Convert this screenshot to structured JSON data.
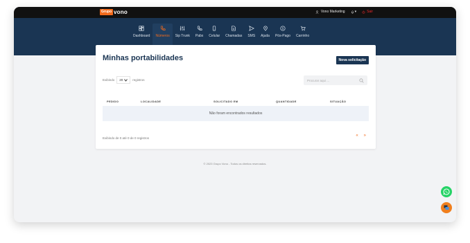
{
  "brand": {
    "badge": "Grupo",
    "name": "vono"
  },
  "topbar": {
    "user_name": "Vono Marketing",
    "bell_caret": "▾",
    "logout_label": "Sair"
  },
  "nav": {
    "items": [
      {
        "label": "Dashboard",
        "icon": "dashboard-icon",
        "active": false
      },
      {
        "label": "Números",
        "icon": "phone-number-icon",
        "active": true
      },
      {
        "label": "Sip Trunk",
        "icon": "sliders-icon",
        "active": false
      },
      {
        "label": "Pabx",
        "icon": "phone-icon",
        "active": false
      },
      {
        "label": "Celular",
        "icon": "mobile-icon",
        "active": false
      },
      {
        "label": "Chamadas",
        "icon": "file-icon",
        "active": false
      },
      {
        "label": "SMS",
        "icon": "send-icon",
        "active": false
      },
      {
        "label": "Ajuda",
        "icon": "help-icon",
        "active": false
      },
      {
        "label": "Pós-Pago",
        "icon": "dollar-icon",
        "active": false
      },
      {
        "label": "Carrinho",
        "icon": "cart-icon",
        "active": false
      }
    ]
  },
  "page": {
    "title": "Minhas portabilidades",
    "new_button": "Nova solicitação",
    "show_prefix": "Exibindo",
    "page_size": "20",
    "show_suffix": "registros",
    "search_placeholder": "Procurar aqui ...",
    "columns": [
      "PEDIDO",
      "LOCALIDADE",
      "SOLICITADO EM",
      "QUANTIDADE",
      "SITUAÇÃO"
    ],
    "empty_message": "Não foram encontrados resultados",
    "footer_info": "Exibindo de 0 até 0 de 0 registros",
    "prev_symbol": "«",
    "next_symbol": "»"
  },
  "footer": {
    "copyright": "© 2023 Grupo Vono - Todos os direitos reservados."
  },
  "colors": {
    "nav_bg": "#1a3553",
    "accent": "#f26b1d",
    "topbar": "#111111",
    "logout": "#e8282b",
    "whatsapp": "#25d366"
  }
}
